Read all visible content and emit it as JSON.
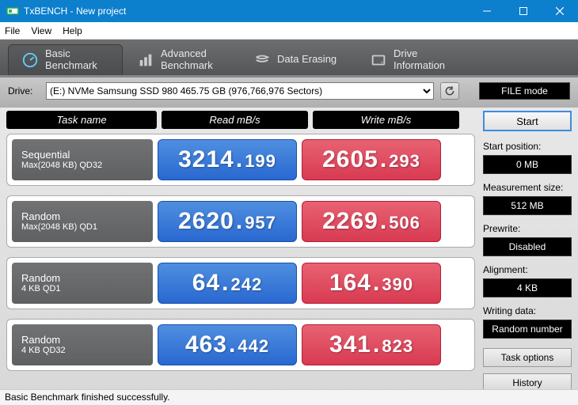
{
  "window": {
    "title": "TxBENCH - New project"
  },
  "menu": {
    "file": "File",
    "view": "View",
    "help": "Help"
  },
  "tabs": {
    "basic": "Basic\nBenchmark",
    "advanced": "Advanced\nBenchmark",
    "erase": "Data Erasing",
    "drive": "Drive\nInformation"
  },
  "drive": {
    "label": "Drive:",
    "selected": "(E:) NVMe Samsung SSD 980  465.75 GB (976,766,976 Sectors)"
  },
  "filemode": "FILE mode",
  "headers": {
    "task": "Task name",
    "read": "Read mB/s",
    "write": "Write mB/s"
  },
  "rows": [
    {
      "t1": "Sequential",
      "t2": "Max(2048 KB) QD32",
      "r_int": "3214",
      "r_dec": "199",
      "w_int": "2605",
      "w_dec": "293"
    },
    {
      "t1": "Random",
      "t2": "Max(2048 KB) QD1",
      "r_int": "2620",
      "r_dec": "957",
      "w_int": "2269",
      "w_dec": "506"
    },
    {
      "t1": "Random",
      "t2": "4 KB QD1",
      "r_int": "64",
      "r_dec": "242",
      "w_int": "164",
      "w_dec": "390"
    },
    {
      "t1": "Random",
      "t2": "4 KB QD32",
      "r_int": "463",
      "r_dec": "442",
      "w_int": "341",
      "w_dec": "823"
    }
  ],
  "side": {
    "start": "Start",
    "startpos_lbl": "Start position:",
    "startpos": "0 MB",
    "msize_lbl": "Measurement size:",
    "msize": "512 MB",
    "prewrite_lbl": "Prewrite:",
    "prewrite": "Disabled",
    "align_lbl": "Alignment:",
    "align": "4 KB",
    "wdata_lbl": "Writing data:",
    "wdata": "Random number",
    "taskopt": "Task options",
    "history": "History"
  },
  "status": "Basic Benchmark finished successfully."
}
